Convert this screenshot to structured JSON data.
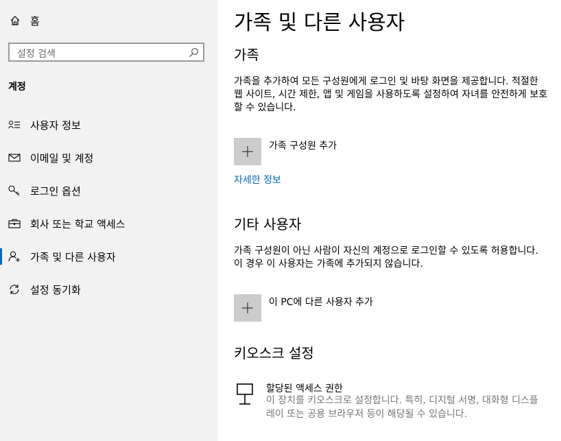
{
  "sidebar": {
    "home_label": "홈",
    "search_placeholder": "설정 검색",
    "section_title": "계정",
    "items": [
      {
        "label": "사용자 정보",
        "icon": "user-info-icon"
      },
      {
        "label": "이메일 및 계정",
        "icon": "mail-icon"
      },
      {
        "label": "로그인 옵션",
        "icon": "key-icon"
      },
      {
        "label": "회사 또는 학교 액세스",
        "icon": "briefcase-icon"
      },
      {
        "label": "가족 및 다른 사용자",
        "icon": "add-user-icon",
        "active": true
      },
      {
        "label": "설정 동기화",
        "icon": "sync-icon"
      }
    ]
  },
  "main": {
    "title": "가족 및 다른 사용자",
    "family": {
      "heading": "가족",
      "description": "가족을 추가하여 모든 구성원에게 로그인 및 바탕 화면을 제공합니다. 적절한 웹 사이트, 시간 제한, 앱 및 게임을 사용하도록 설정하여 자녀를 안전하게 보호할 수 있습니다.",
      "add_label": "가족 구성원 추가",
      "learn_more": "자세한 정보"
    },
    "other_users": {
      "heading": "기타 사용자",
      "description": "가족 구성원이 아닌 사람이 자신의 계정으로 로그인할 수 있도록 허용합니다. 이 경우 이 사용자는 가족에 추가되지 않습니다.",
      "add_label": "이 PC에 다른 사용자 추가"
    },
    "kiosk": {
      "heading": "키오스크 설정",
      "title": "할당된 액세스 권한",
      "description": "이 장치를 키오스크로 설정합니다. 특히, 디지털 서명, 대화형 디스플레이 또는 공용 브라우저 등이 해당될 수 있습니다."
    }
  },
  "colors": {
    "accent": "#0067c0",
    "sidebar_bg": "#f2f2f2",
    "button_bg": "#cccccc"
  }
}
